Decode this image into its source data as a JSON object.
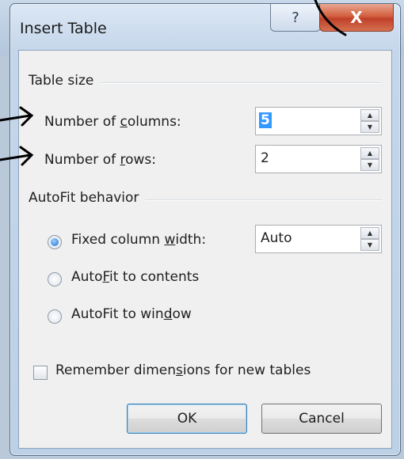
{
  "window": {
    "title": "Insert Table",
    "help_glyph": "?",
    "close_glyph": "X"
  },
  "table_size": {
    "label": "Table size",
    "columns": {
      "label_pre": "Number of ",
      "label_mn": "c",
      "label_post": "olumns:",
      "value": "5"
    },
    "rows": {
      "label_pre": "Number of ",
      "label_mn": "r",
      "label_post": "ows:",
      "value": "2"
    }
  },
  "autofit": {
    "label": "AutoFit behavior",
    "fixed": {
      "label_pre": "Fixed column ",
      "label_mn": "w",
      "label_post": "idth:",
      "value": "Auto",
      "selected": true
    },
    "contents": {
      "label_pre": "Auto",
      "label_mn": "F",
      "label_post": "it to contents",
      "selected": false
    },
    "window": {
      "label_pre": "AutoFit to win",
      "label_mn": "d",
      "label_post": "ow",
      "selected": false
    }
  },
  "remember": {
    "label_pre": "Remember dimen",
    "label_mn": "s",
    "label_post": "ions for new tables",
    "checked": false
  },
  "buttons": {
    "ok": "OK",
    "cancel": "Cancel"
  },
  "colors": {
    "selection": "#3399ff",
    "close": "#c7452e",
    "frame": "#c4d6ea"
  }
}
